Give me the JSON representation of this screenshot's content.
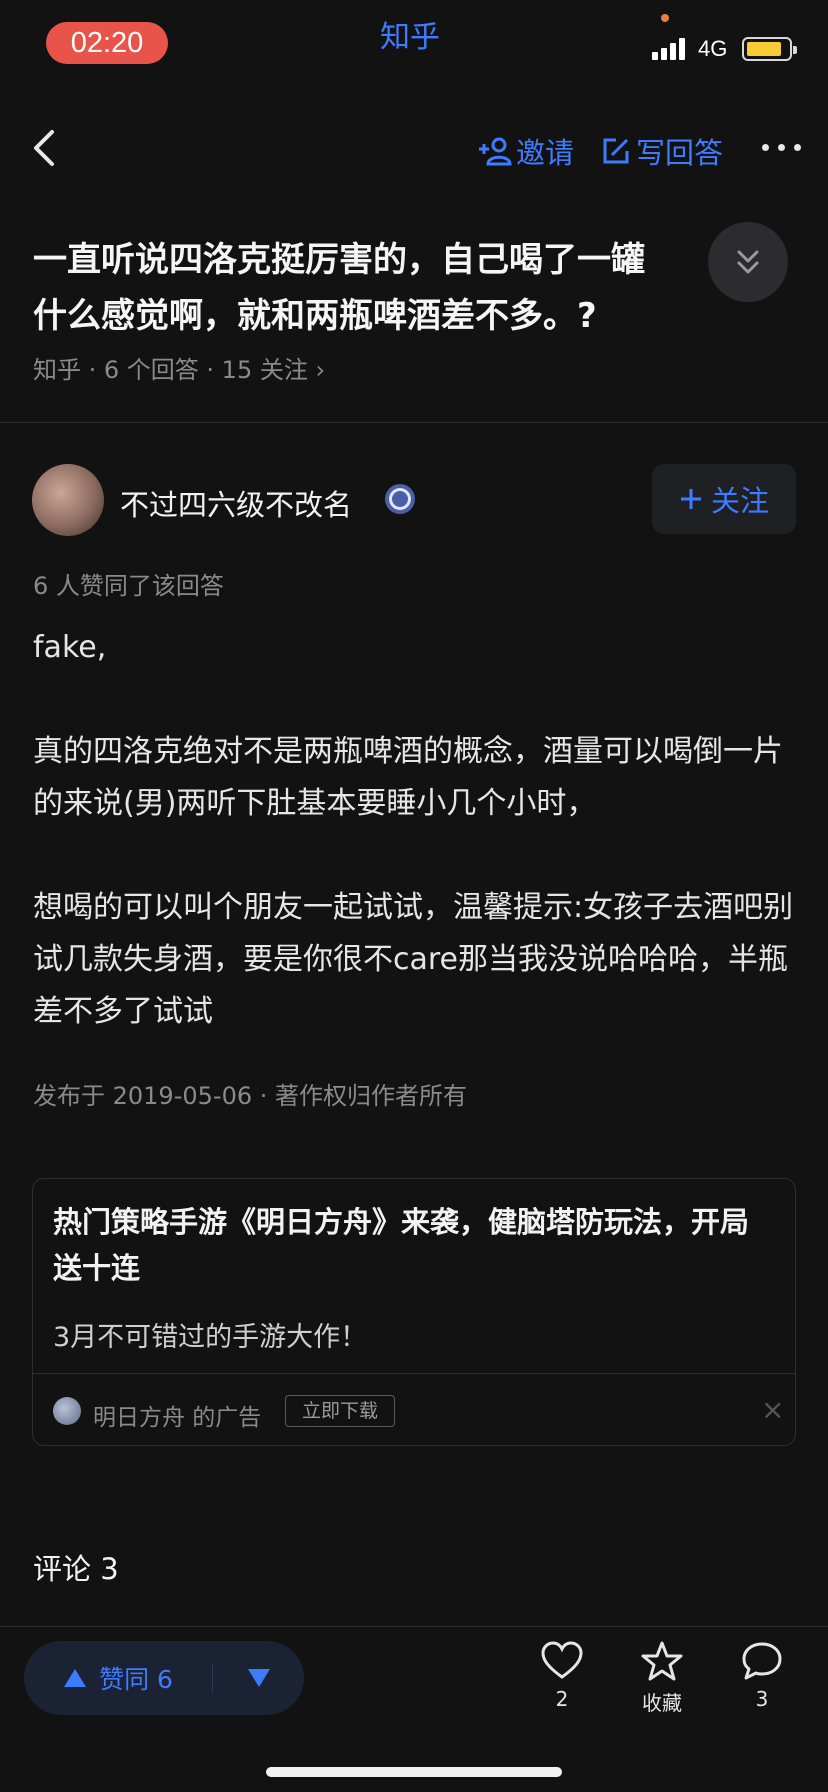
{
  "status_bar": {
    "time": "02:20",
    "app_name": "知乎",
    "network": "4G"
  },
  "nav": {
    "invite_label": "邀请",
    "write_label": "写回答"
  },
  "question": {
    "title_line1": "一直听说四洛克挺厉害的，自己喝了一罐",
    "title_line2": "什么感觉啊，就和两瓶啤酒差不多。?",
    "meta": "知乎 · 6 个回答 · 15 关注 ›"
  },
  "author": {
    "name": "不过四六级不改名",
    "follow_label": "关注"
  },
  "answer": {
    "votes_text": "6 人赞同了该回答",
    "paragraphs": [
      "fake,",
      "真的四洛克绝对不是两瓶啤酒的概念，酒量可以喝倒一片的来说(男)两听下肚基本要睡小几个小时，",
      "想喝的可以叫个朋友一起试试，温馨提示:女孩子去酒吧别试几款失身酒，要是你很不care那当我没说哈哈哈，半瓶差不多了试试"
    ],
    "meta": "发布于 2019-05-06 · 著作权归作者所有"
  },
  "ad": {
    "title": "热门策略手游《明日方舟》来袭，健脑塔防玩法，开局送十连",
    "subtitle": "3月不可错过的手游大作！",
    "source": "明日方舟 的广告",
    "download_label": "立即下载",
    "close_icon": "×"
  },
  "comments": {
    "title": "评论 3"
  },
  "bottom_bar": {
    "upvote_label": "赞同 6",
    "like_count": "2",
    "favorite_label": "收藏",
    "comment_count": "3"
  },
  "colors": {
    "accent": "#3d7bff",
    "background": "#121212",
    "time_pill": "#e9544a"
  }
}
